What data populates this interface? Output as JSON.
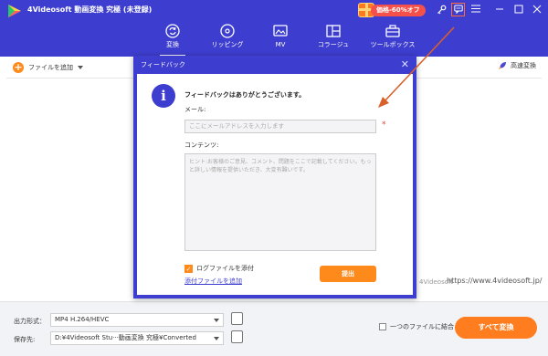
{
  "app": {
    "title": "4Videosoft 動画変換 究極 (未登録)",
    "promo_badge": "価格-60%オフ"
  },
  "nav": {
    "tabs": [
      {
        "label": "変換",
        "icon": "convert-icon",
        "active": true
      },
      {
        "label": "リッピング",
        "icon": "ripper-icon",
        "active": false
      },
      {
        "label": "MV",
        "icon": "mv-icon",
        "active": false
      },
      {
        "label": "コラージュ",
        "icon": "collage-icon",
        "active": false
      },
      {
        "label": "ツールボックス",
        "icon": "toolbox-icon",
        "active": false
      }
    ]
  },
  "toolbar": {
    "add_file_label": "ファイルを追加",
    "fast_convert_label": "高速変換"
  },
  "main": {
    "watermark": "4Videosoft",
    "url": "https://www.4videosoft.jp/"
  },
  "bottom": {
    "output_format_label": "出力形式：",
    "output_format_value": "MP4 H.264/HEVC",
    "save_to_label": "保存先:",
    "save_to_value": "D:¥4Videosoft Stu···動画変換 究極¥Converted",
    "merge_label": "一つのファイルに結合",
    "convert_all_label": "すべて変換"
  },
  "dialog": {
    "title": "フィードバック",
    "message": "フィードバックはありがとうございます。",
    "email_label": "メール:",
    "email_placeholder": "ここにメールアドレスを入力します",
    "required_mark": "*",
    "content_label": "コンテンツ:",
    "content_placeholder": "ヒント:お客様のご意見、コメント、問題をここで記載してください。もっと詳しい情報を提供いただき、大変有難いです。",
    "attach_log_label": "ログファイルを添付",
    "attach_log_checked": true,
    "attach_file_link": "添付ファイルを追加",
    "submit_label": "提出"
  },
  "colors": {
    "brand": "#3d3ecf",
    "accent": "#ff8a1c",
    "promo": "#f5504a",
    "annotation": "#d9602a"
  }
}
